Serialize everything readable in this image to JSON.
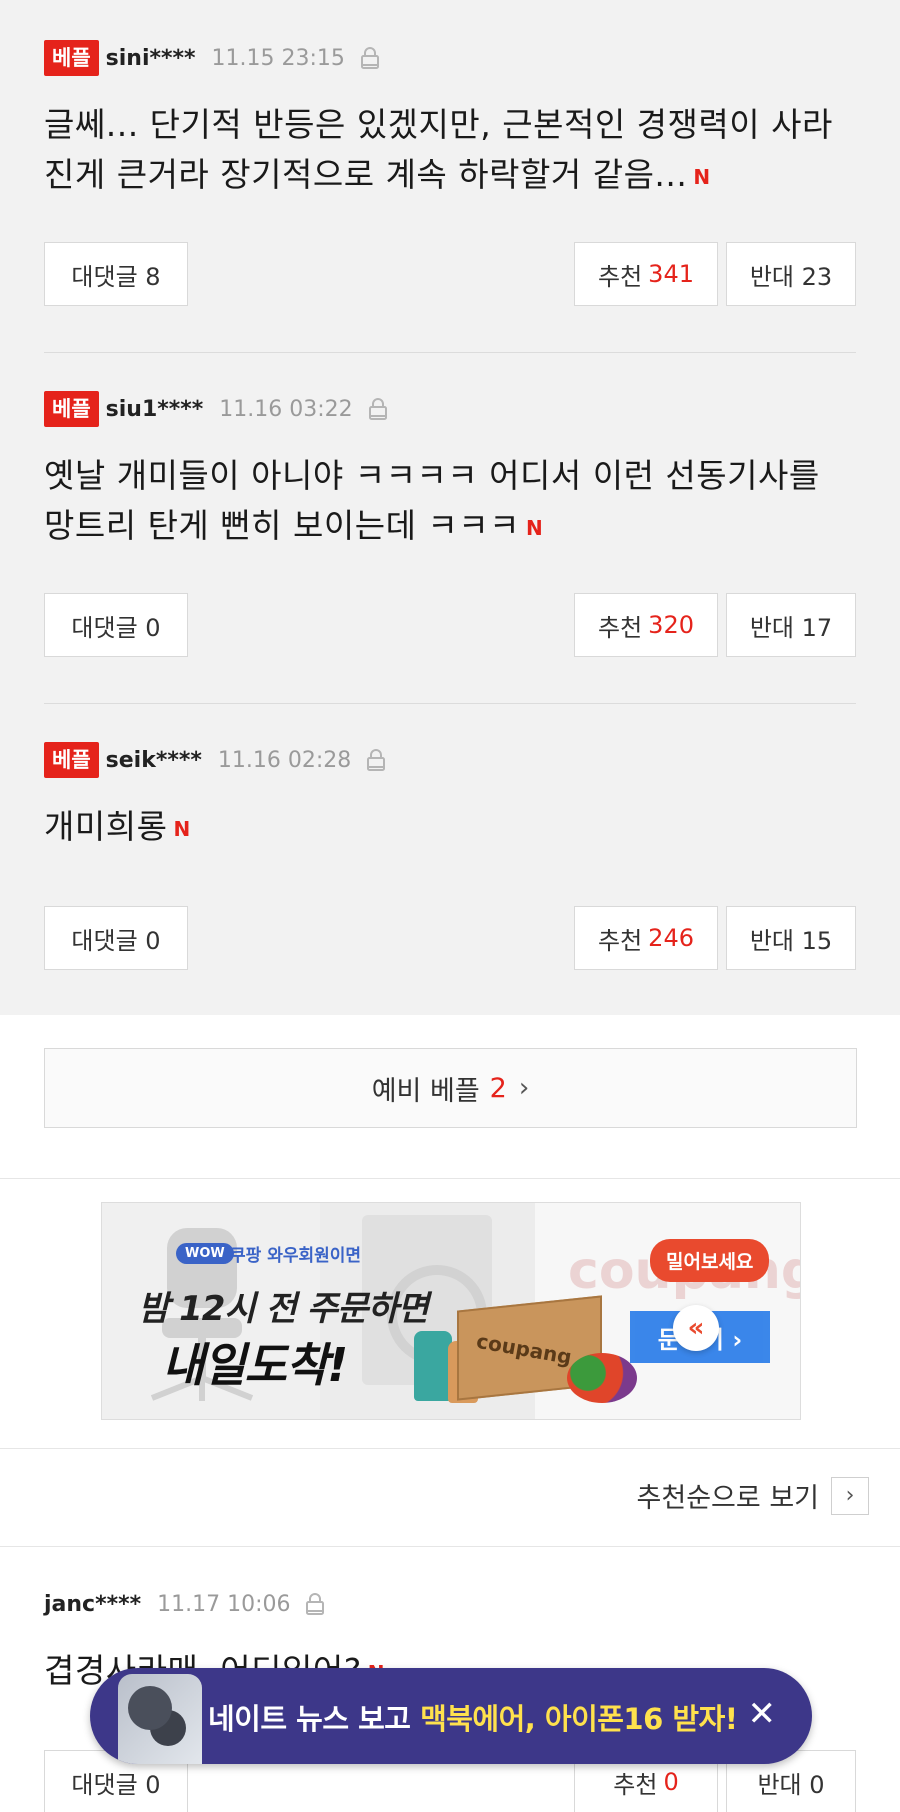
{
  "best_comments": [
    {
      "badge": "베플",
      "user": "sini****",
      "time": "11.15 23:15",
      "text": "글쎄... 단기적 반등은 있겠지만, 근본적인 경쟁력이 사라진게 큰거라 장기적으로 계속 하락할거 같음...",
      "new_mark": "N",
      "reply_label": "대댓글 8",
      "up_label": "추천",
      "up_count": "341",
      "down_label": "반대 23"
    },
    {
      "badge": "베플",
      "user": "siu1****",
      "time": "11.16 03:22",
      "text": "옛날 개미들이 아니야 ㅋㅋㅋㅋ 어디서 이런 선동기사를 망트리 탄게 뻔히 보이는데 ㅋㅋㅋ",
      "new_mark": "N",
      "reply_label": "대댓글 0",
      "up_label": "추천",
      "up_count": "320",
      "down_label": "반대 17"
    },
    {
      "badge": "베플",
      "user": "seik****",
      "time": "11.16 02:28",
      "text": "개미희롱",
      "new_mark": "N",
      "reply_label": "대댓글 0",
      "up_label": "추천",
      "up_count": "246",
      "down_label": "반대 15"
    }
  ],
  "prebest": {
    "label": "예비 베플",
    "count": "2",
    "chevron": "›"
  },
  "ad": {
    "wow": "WOW",
    "wow_text": "쿠팡 와우회원이면",
    "line1": "밤 12시 전 주문하면",
    "line2": "내일도착!",
    "box_label": "coupang",
    "logo": "coupang",
    "pill": "밀어보세요",
    "order": "문하기 ›",
    "arrow": "«"
  },
  "sort": {
    "label": "추천순으로 보기",
    "chevron": "›"
  },
  "comment4": {
    "user": "janc****",
    "time": "11.17 10:06",
    "text": "겹경사라매, 어디있어?",
    "new_mark": "N",
    "reply_label": "대댓글 0",
    "up_label": "추천",
    "up_count": "0",
    "down_label": "반대 0"
  },
  "banner": {
    "text_before": "네이트 뉴스 보고 ",
    "text_highlight": "맥북에어, 아이폰16 받자!",
    "close": "✕"
  },
  "colors": {
    "accent_red": "#e5231b",
    "banner_bg": "#3d3789",
    "highlight": "#ffe14d"
  },
  "icons": {
    "lock": "lock-icon",
    "close": "close-icon",
    "chevron": "chevron-right-icon"
  }
}
